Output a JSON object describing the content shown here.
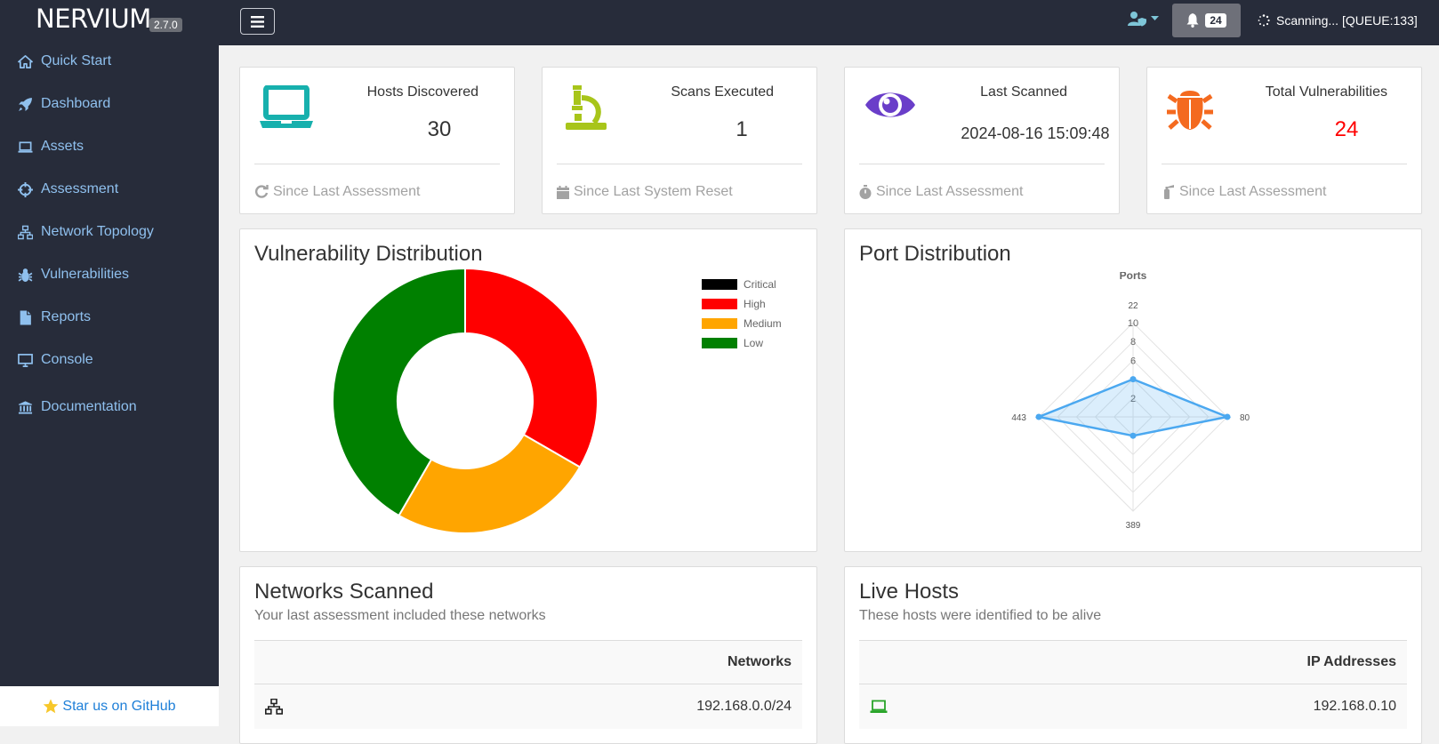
{
  "app": {
    "name": "NERVIUM",
    "version": "2.7.0"
  },
  "topbar": {
    "notification_count": "24",
    "scan_status": "Scanning... [QUEUE:133]"
  },
  "sidebar": {
    "items": [
      {
        "label": "Quick Start",
        "icon": "home-icon"
      },
      {
        "label": "Dashboard",
        "icon": "rocket-icon"
      },
      {
        "label": "Assets",
        "icon": "laptop-icon"
      },
      {
        "label": "Assessment",
        "icon": "crosshairs-icon"
      },
      {
        "label": "Network Topology",
        "icon": "sitemap-icon"
      },
      {
        "label": "Vulnerabilities",
        "icon": "bug-icon"
      },
      {
        "label": "Reports",
        "icon": "file-icon"
      },
      {
        "label": "Console",
        "icon": "desktop-icon"
      },
      {
        "label": "Documentation",
        "icon": "university-icon"
      }
    ],
    "github_label": "Star us on GitHub"
  },
  "stats": [
    {
      "title": "Hosts Discovered",
      "value": "30",
      "footer": "Since Last Assessment",
      "color": "#17b0ad"
    },
    {
      "title": "Scans Executed",
      "value": "1",
      "footer": "Since Last System Reset",
      "color": "#a8c51a"
    },
    {
      "title": "Last Scanned",
      "value": "2024-08-16 15:09:48",
      "footer": "Since Last Assessment",
      "color": "#6a3ec9"
    },
    {
      "title": "Total Vulnerabilities",
      "value": "24",
      "footer": "Since Last Assessment",
      "color": "#f46a1f",
      "value_color": "#ff0000"
    }
  ],
  "vuln_panel": {
    "title": "Vulnerability Distribution"
  },
  "port_panel": {
    "title": "Port Distribution"
  },
  "chart_data": [
    {
      "type": "pie",
      "categories": [
        "Critical",
        "High",
        "Medium",
        "Low"
      ],
      "values": [
        0,
        8,
        6,
        10
      ],
      "colors": [
        "#000000",
        "#ff0000",
        "#ffa500",
        "#008000"
      ],
      "legend": "top-right"
    },
    {
      "type": "radar",
      "title": "Ports",
      "categories": [
        "22",
        "80",
        "389",
        "443"
      ],
      "values": [
        4,
        10,
        2,
        10
      ],
      "rmax": 10,
      "ticks": [
        2,
        6,
        8,
        10
      ],
      "color": "#4ba8f0"
    }
  ],
  "networks": {
    "title": "Networks Scanned",
    "subtitle": "Your last assessment included these networks",
    "column": "Networks",
    "rows": [
      "192.168.0.0/24"
    ]
  },
  "hosts": {
    "title": "Live Hosts",
    "subtitle": "These hosts were identified to be alive",
    "column": "IP Addresses",
    "rows": [
      "192.168.0.10"
    ]
  }
}
